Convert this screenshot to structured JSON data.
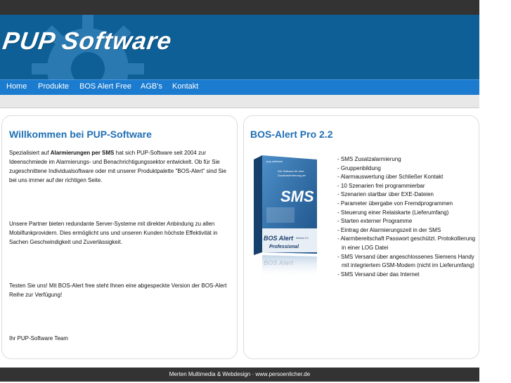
{
  "header": {
    "logo_text": "PUP Software"
  },
  "nav": {
    "items": [
      "Home",
      "Produkte",
      "BOS Alert Free",
      "AGB's",
      "Kontakt"
    ]
  },
  "left": {
    "title": "Willkommen bei PUP-Software",
    "p1_prefix": "Spezialisiert auf ",
    "p1_bold": "Alarmierungen per SMS",
    "p1_rest": " hat sich PUP-Software seit 2004 zur Ideenschmiede im Alarmierungs- und Benachrichtigungssektor entwickelt. Ob für Sie zugeschnittene Individualsoftware oder mit unserer Produktpalette \"BOS-Alert\" sind Sie bei uns immer auf der richtigen Seite.",
    "p2": "Unsere Partner bieten redundante Server-Systeme mit direkter Anbindung zu allen Mobilfunkprovidern. Dies ermöglicht uns und unseren Kunden höchste Effektivität in Sachen Geschwindigkeit und Zuverlässigkeit.",
    "p3": "Testen Sie uns! Mit BOS-Alert free steht Ihnen eine abgespeckte Version der BOS-Alert Reihe zur Verfügung!",
    "p4": "Ihr PUP-Software Team"
  },
  "right": {
    "title": "BOS-Alert Pro 2.2",
    "box": {
      "brand": "pup-software",
      "tagline1": "Die Software für eine",
      "tagline2": "Zusatzalarmierung per",
      "sms": "SMS",
      "name": "BOS Alert",
      "version": "Version 2.0",
      "edition": "Professional"
    },
    "features": [
      "SMS Zusatzalarmierung",
      "Gruppenbildung",
      "Alarmauswertung über Schließer Kontakt",
      "10 Szenarien frei programmierbar",
      "Szenarien startbar über EXE-Dateien",
      "Parameter übergabe von Fremdprogrammen",
      "Steuerung einer Relaiskarte (Lieferumfang)",
      "Starten externer Programme",
      "Eintrag der Alarmierungszeit in der SMS",
      "Alarmbereitschaft Passwort geschützt. Protokollierung in einer LOG Datei",
      "SMS Versand über angeschlossenes Siemens Handy mit integriertem GSM-Modem (nicht im Lieferumfang)",
      "SMS Versand über das Internet"
    ]
  },
  "footer": {
    "text": "Merten Multimedia & Webdesign · www.persoenlicher.de"
  },
  "colors": {
    "banner": "#0e5f96",
    "nav": "#1a7bcf",
    "heading": "#1f6fb4",
    "dark_bar": "#333333"
  }
}
